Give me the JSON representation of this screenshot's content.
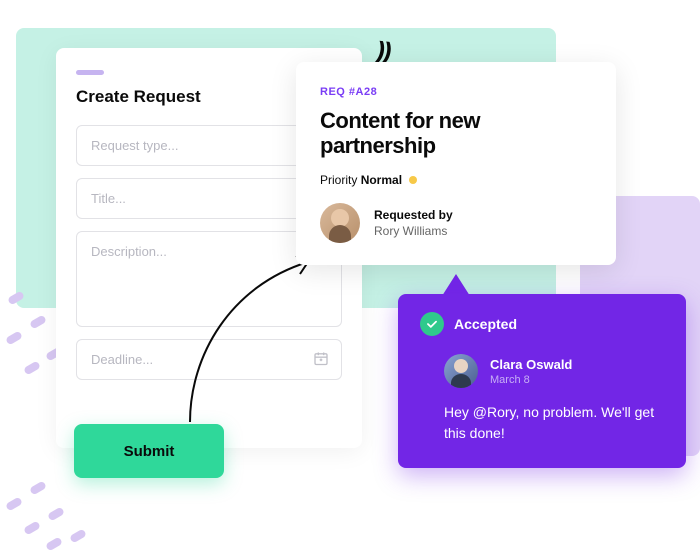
{
  "create": {
    "title": "Create Request",
    "fields": {
      "type_placeholder": "Request type...",
      "title_placeholder": "Title...",
      "description_placeholder": "Description...",
      "deadline_placeholder": "Deadline..."
    },
    "submit_label": "Submit"
  },
  "detail": {
    "id_label": "REQ #A28",
    "title": "Content for new partnership",
    "priority_label": "Priority",
    "priority_value": "Normal",
    "priority_color": "#f7c948",
    "requested_by_label": "Requested by",
    "requester_name": "Rory Williams"
  },
  "accepted": {
    "status_label": "Accepted",
    "responder_name": "Clara Oswald",
    "date": "March 8",
    "message": "Hey @Rory, no problem. We'll get this done!"
  },
  "colors": {
    "accent": "#7226e6",
    "success": "#2fd89a",
    "mint": "#c5f1e5",
    "lilac": "#e2d4f7"
  }
}
